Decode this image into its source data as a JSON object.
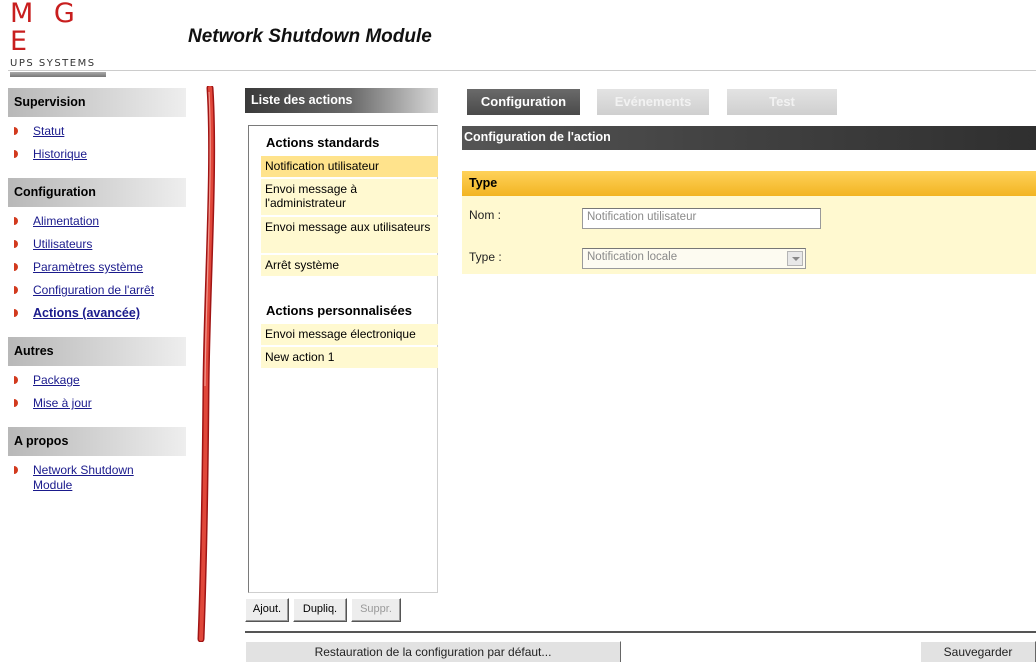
{
  "logo": {
    "main": "M G E",
    "sub": "UPS SYSTEMS"
  },
  "app_title": "Network Shutdown Module",
  "nav": {
    "sections": [
      {
        "title": "Supervision",
        "items": [
          "Statut",
          "Historique"
        ]
      },
      {
        "title": "Configuration",
        "items": [
          "Alimentation",
          "Utilisateurs",
          "Paramètres système",
          "Configuration de l'arrêt",
          "Actions (avancée)"
        ],
        "active": "Actions (avancée)"
      },
      {
        "title": "Autres",
        "items": [
          "Package",
          "Mise à jour"
        ]
      },
      {
        "title": "A propos",
        "items": [
          "Network Shutdown\nModule"
        ]
      }
    ]
  },
  "actions_panel": {
    "title": "Liste des actions",
    "standard_title": "Actions standards",
    "standard_items": [
      "Notification utilisateur",
      "Envoi message à l'administrateur",
      "Envoi message aux utilisateurs",
      "Arrêt système"
    ],
    "custom_title": "Actions personnalisées",
    "custom_items": [
      "Envoi message électronique",
      "New action 1"
    ],
    "buttons": {
      "add": "Ajout.",
      "duplicate": "Dupliq.",
      "delete": "Suppr."
    }
  },
  "tabs": [
    "Configuration",
    "Evénements",
    "Test"
  ],
  "config": {
    "header": "Configuration de l'action",
    "section": "Type",
    "name_label": "Nom :",
    "name_value": "Notification utilisateur",
    "type_label": "Type :",
    "type_value": "Notification locale"
  },
  "footer": {
    "restore_label": "Restauration de la configuration par défaut...",
    "save_label": "Sauvegarder"
  },
  "colors": {
    "accent_red": "#d23a1e",
    "section_yellow": "#f2b422",
    "row_yellow": "#fff9d0",
    "selected_row": "#ffe38c"
  }
}
